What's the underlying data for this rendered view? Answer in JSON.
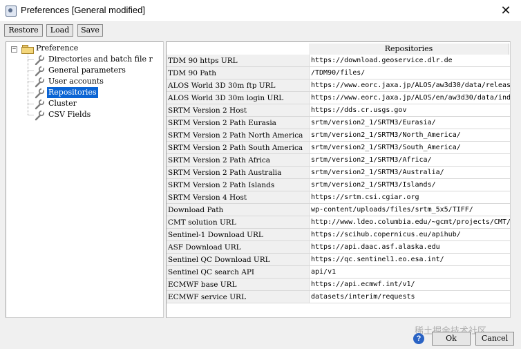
{
  "window": {
    "title": "Preferences [General modified]",
    "close_glyph": "✕"
  },
  "toolbar": {
    "restore_label": "Restore",
    "load_label": "Load",
    "save_label": "Save"
  },
  "tree": {
    "root": {
      "label": "Preference",
      "expander": "−",
      "icon": "folder-open-icon"
    },
    "items": [
      {
        "label": "Directories and batch file r",
        "icon": "wrench-icon"
      },
      {
        "label": "General parameters",
        "icon": "wrench-icon"
      },
      {
        "label": "User accounts",
        "icon": "wrench-icon"
      },
      {
        "label": "Repositories",
        "icon": "wrench-icon",
        "selected": true
      },
      {
        "label": "Cluster",
        "icon": "wrench-icon"
      },
      {
        "label": "CSV Fields",
        "icon": "wrench-icon"
      }
    ]
  },
  "table": {
    "column_header": "Repositories",
    "rows": [
      {
        "name": "TDM 90 https URL",
        "value": "https://download.geoservice.dlr.de"
      },
      {
        "name": "TDM 90 Path",
        "value": "/TDM90/files/"
      },
      {
        "name": "ALOS World 3D 30m ftp URL",
        "value": "https://www.eorc.jaxa.jp/ALOS/aw3d30/data/releas"
      },
      {
        "name": "ALOS World 3D 30m login URL",
        "value": "https://www.eorc.jaxa.jp/ALOS/en/aw3d30/data/ind"
      },
      {
        "name": "SRTM Version 2 Host",
        "value": "https://dds.cr.usgs.gov"
      },
      {
        "name": "SRTM Version 2 Path Eurasia",
        "value": "srtm/version2_1/SRTM3/Eurasia/"
      },
      {
        "name": "SRTM Version 2 Path North America",
        "value": "srtm/version2_1/SRTM3/North_America/"
      },
      {
        "name": "SRTM Version 2 Path South America",
        "value": "srtm/version2_1/SRTM3/South_America/"
      },
      {
        "name": "SRTM Version 2 Path Africa",
        "value": "srtm/version2_1/SRTM3/Africa/"
      },
      {
        "name": "SRTM Version 2 Path Australia",
        "value": "srtm/version2_1/SRTM3/Australia/"
      },
      {
        "name": "SRTM Version 2 Path Islands",
        "value": "srtm/version2_1/SRTM3/Islands/"
      },
      {
        "name": "SRTM Version 4 Host",
        "value": "https://srtm.csi.cgiar.org"
      },
      {
        "name": "Download Path",
        "value": "wp-content/uploads/files/srtm_5x5/TIFF/"
      },
      {
        "name": "CMT solution URL",
        "value": "http://www.ldeo.columbia.edu/~gcmt/projects/CMT/"
      },
      {
        "name": "Sentinel-1 Download URL",
        "value": "https://scihub.copernicus.eu/apihub/"
      },
      {
        "name": "ASF Download URL",
        "value": "https://api.daac.asf.alaska.edu"
      },
      {
        "name": "Sentinel QC Download URL",
        "value": "https://qc.sentinel1.eo.esa.int/"
      },
      {
        "name": "Sentinel QC search API",
        "value": "api/v1"
      },
      {
        "name": "ECMWF base URL",
        "value": "https://api.ecmwf.int/v1/"
      },
      {
        "name": "ECMWF service URL",
        "value": "datasets/interim/requests"
      }
    ]
  },
  "footer": {
    "help_glyph": "?",
    "ok_label": "Ok",
    "cancel_label": "Cancel"
  },
  "watermark": "稀土掘金技术社区"
}
